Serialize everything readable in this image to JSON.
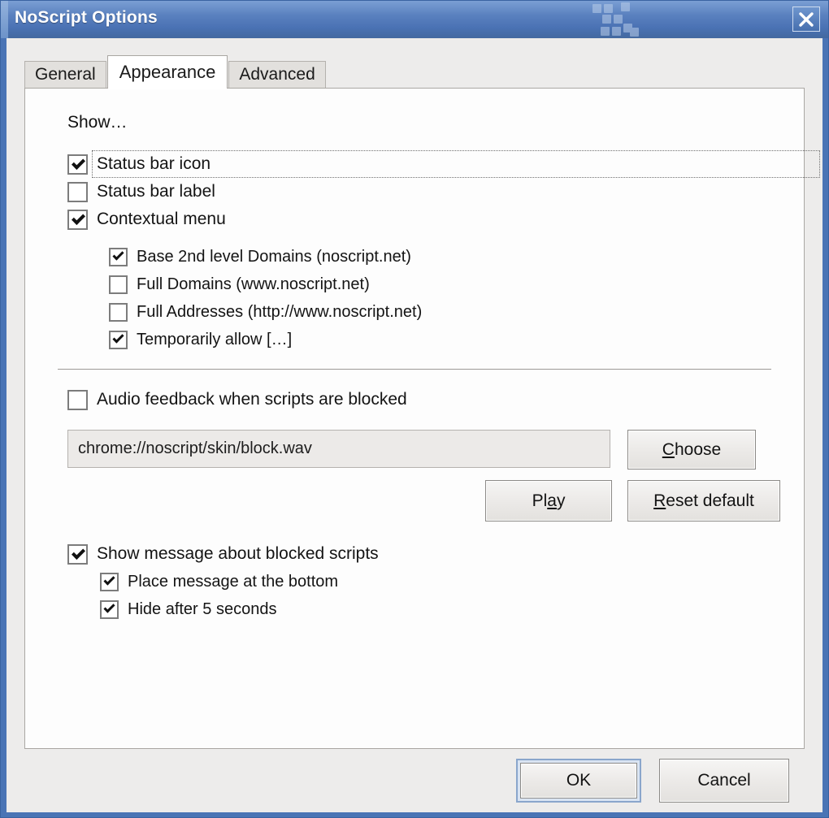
{
  "window": {
    "title": "NoScript Options",
    "close_label": "×",
    "accent_color": "#4a74b5",
    "titlebar_gradient_top": "#7b9fd4",
    "titlebar_gradient_bottom": "#43699f"
  },
  "tabs": [
    {
      "label": "General",
      "active": false
    },
    {
      "label": "Appearance",
      "active": true
    },
    {
      "label": "Advanced",
      "active": false
    }
  ],
  "appearance": {
    "section_label": "Show…",
    "show_options": [
      {
        "label": "Status bar icon",
        "checked": true,
        "focused": true
      },
      {
        "label": "Status bar label",
        "checked": false,
        "focused": false
      },
      {
        "label": "Contextual menu",
        "checked": true,
        "focused": false
      }
    ],
    "context_menu_options": [
      {
        "label": "Base 2nd level Domains (noscript.net)",
        "checked": true
      },
      {
        "label": "Full Domains (www.noscript.net)",
        "checked": false
      },
      {
        "label": "Full Addresses (http://www.noscript.net)",
        "checked": false
      },
      {
        "label": "Temporarily allow […]",
        "checked": true
      }
    ],
    "audio": {
      "checkbox_label": "Audio feedback when scripts are blocked",
      "checkbox_checked": false,
      "sound_path": "chrome://noscript/skin/block.wav",
      "sound_path_enabled": false,
      "choose_button": {
        "before": "",
        "accel": "C",
        "after": "hoose"
      },
      "play_button": {
        "before": "Pl",
        "accel": "a",
        "after": "y"
      },
      "reset_button": {
        "before": "",
        "accel": "R",
        "after": "eset default"
      }
    },
    "message_options": {
      "parent": {
        "label": "Show message about blocked scripts",
        "checked": true
      },
      "children": [
        {
          "label": "Place message at the bottom",
          "checked": true
        },
        {
          "label": "Hide after 5 seconds",
          "checked": true
        }
      ]
    }
  },
  "dialog_buttons": {
    "ok": "OK",
    "cancel": "Cancel",
    "default_button": "ok"
  }
}
